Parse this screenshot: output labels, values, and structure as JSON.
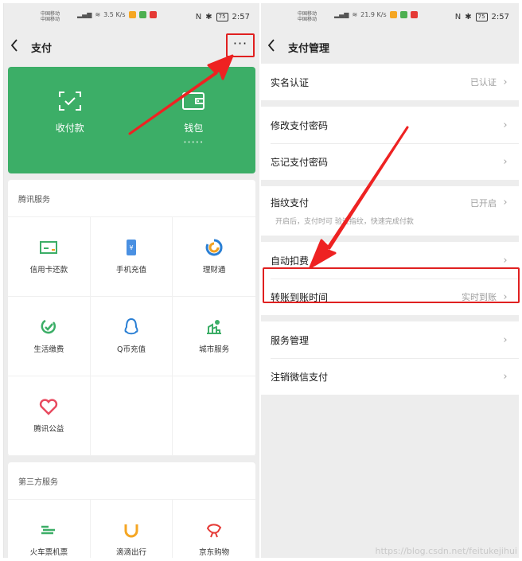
{
  "left": {
    "status": {
      "carrier1": "中国移动",
      "carrier2": "中国移动",
      "speed": "3.5 K/s",
      "battery": "75",
      "time": "2:57"
    },
    "nav": {
      "back_icon": "back-chevron-icon",
      "title": "支付",
      "more": "···"
    },
    "card": {
      "items": [
        {
          "label": "收付款",
          "icon": "scan-pay-icon"
        },
        {
          "label": "钱包",
          "icon": "wallet-icon"
        }
      ],
      "wallet_dots": "•••••"
    },
    "tencent": {
      "title": "腾讯服务",
      "items": [
        {
          "label": "信用卡还款",
          "icon": "credit-card-icon"
        },
        {
          "label": "手机充值",
          "icon": "mobile-topup-icon"
        },
        {
          "label": "理财通",
          "icon": "wealth-icon"
        },
        {
          "label": "生活缴费",
          "icon": "utility-bill-icon"
        },
        {
          "label": "Q币充值",
          "icon": "qq-coin-icon"
        },
        {
          "label": "城市服务",
          "icon": "city-service-icon"
        },
        {
          "label": "腾讯公益",
          "icon": "charity-icon"
        }
      ]
    },
    "third": {
      "title": "第三方服务",
      "items": [
        {
          "label": "火车票机票",
          "icon": "train-ticket-icon"
        },
        {
          "label": "滴滴出行",
          "icon": "didi-icon"
        },
        {
          "label": "京东购物",
          "icon": "jd-shopping-icon"
        }
      ]
    }
  },
  "right": {
    "status": {
      "carrier1": "中国移动",
      "carrier2": "中国移动",
      "speed": "21.9 K/s",
      "battery": "75",
      "time": "2:57"
    },
    "nav": {
      "title": "支付管理"
    },
    "rows": {
      "realname": {
        "label": "实名认证",
        "value": "已认证"
      },
      "change_pwd": {
        "label": "修改支付密码"
      },
      "forgot_pwd": {
        "label": "忘记支付密码"
      },
      "fingerprint": {
        "label": "指纹支付",
        "value": "已开启",
        "sub": "开启后，支付时可 验证指纹，快速完成付款"
      },
      "auto_deduct": {
        "label": "自动扣费"
      },
      "transfer_time": {
        "label": "转账到账时间",
        "value": "实时到账"
      },
      "service_mgmt": {
        "label": "服务管理"
      },
      "cancel_pay": {
        "label": "注销微信支付"
      }
    },
    "chevron": "›"
  },
  "watermark": "https://blog.csdn.net/feitukejihui",
  "colors": {
    "green": "#3cae67",
    "highlight_red": "#e02020",
    "arrow_red": "#ee2222",
    "background": "#ededed"
  }
}
